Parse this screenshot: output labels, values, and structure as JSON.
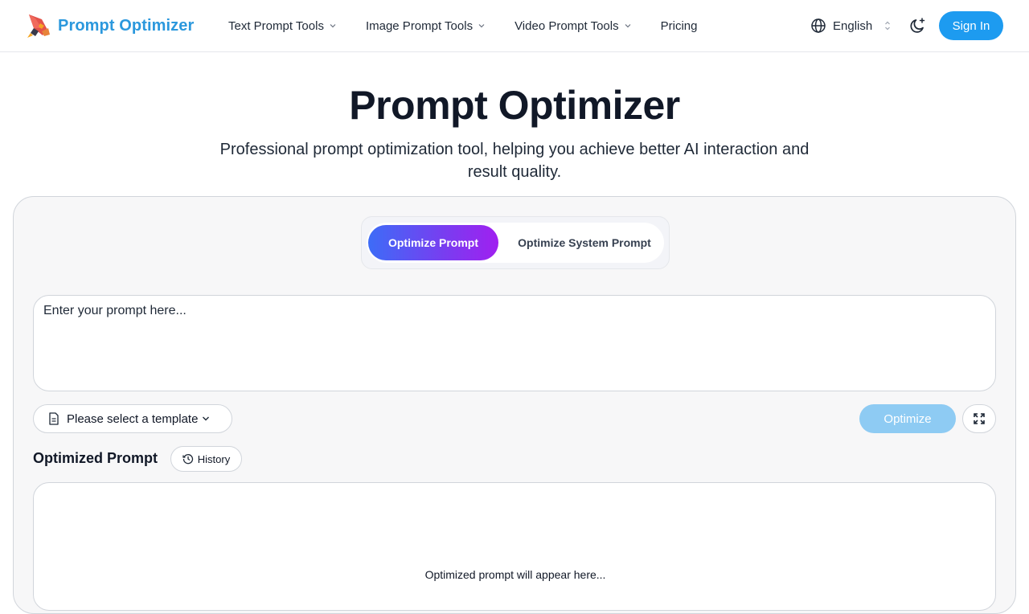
{
  "header": {
    "brand_name": "Prompt Optimizer",
    "brand_color": "#2b98dd",
    "nav": [
      {
        "label": "Text Prompt Tools",
        "icon": "chevron-down-icon"
      },
      {
        "label": "Image Prompt Tools",
        "icon": "chevron-down-icon"
      },
      {
        "label": "Video Prompt Tools",
        "icon": "chevron-down-icon"
      },
      {
        "label": "Pricing"
      }
    ],
    "language": "English",
    "theme_icon": "moon-sparkle-icon",
    "signin_label": "Sign In",
    "signin_color": "#1d9bf0"
  },
  "hero": {
    "title": "Prompt Optimizer",
    "subtitle": "Professional prompt optimization tool, helping you achieve better AI interaction and result quality."
  },
  "main": {
    "modes": [
      {
        "label": "Optimize Prompt",
        "active": true
      },
      {
        "label": "Optimize System Prompt",
        "active": false
      }
    ],
    "prompt_placeholder": "Enter your prompt here...",
    "prompt_value": "",
    "template_placeholder": "Please select a template",
    "optimize_label": "Optimize",
    "optimize_color": "#8ecbf3",
    "output_label": "Optimized Prompt",
    "history_label": "History",
    "output_placeholder": "Optimized prompt will appear here..."
  }
}
